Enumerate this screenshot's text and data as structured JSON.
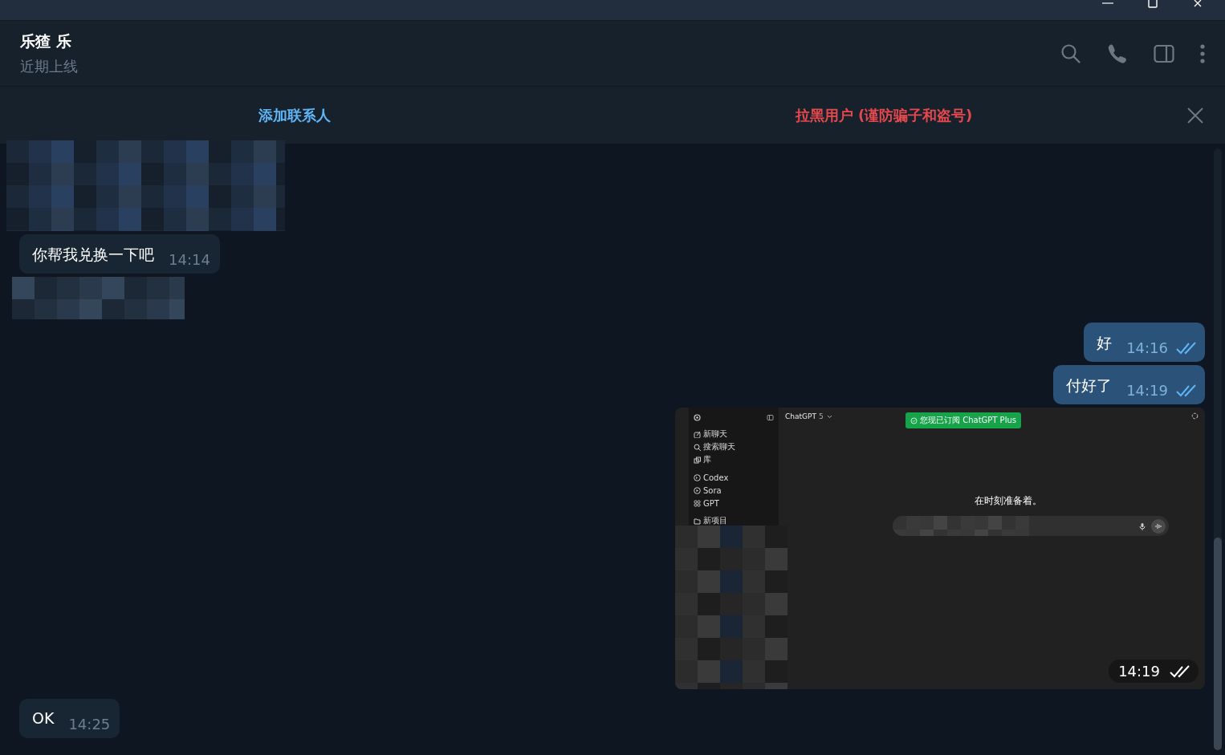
{
  "chat_header": {
    "name": "乐猹 乐",
    "status": "近期上线"
  },
  "action_bar": {
    "buttons": [
      {
        "label": "添加联系人",
        "kind": "add"
      },
      {
        "label": "拉黑用户 (谨防骗子和盗号)",
        "kind": "block"
      }
    ]
  },
  "messages": [
    {
      "kind": "picture",
      "outgoing": false
    },
    {
      "kind": "text",
      "outgoing": false,
      "text": "你帮我兑换一下吧",
      "time": "14:14"
    },
    {
      "kind": "picture",
      "outgoing": false
    },
    {
      "kind": "text",
      "outgoing": true,
      "text": "好",
      "time": "14:16",
      "read": true
    },
    {
      "kind": "text",
      "outgoing": true,
      "text": "付好了",
      "time": "14:19",
      "read": true
    },
    {
      "kind": "screenshot",
      "outgoing": true,
      "time": "14:19",
      "read": true,
      "screenshot": {
        "title": "ChatGPT",
        "model": "5",
        "badge": "您现已订阅 ChatGPT Plus",
        "prompt": "在时刻准备着。",
        "sidebar": {
          "sections": [
            {
              "items": [
                {
                  "label": "新聊天",
                  "kind": "edit"
                },
                {
                  "label": "搜索聊天",
                  "kind": "search"
                },
                {
                  "label": "库",
                  "kind": "library"
                }
              ]
            },
            {
              "items": [
                {
                  "label": "Codex",
                  "kind": "codex"
                },
                {
                  "label": "Sora",
                  "kind": "play"
                },
                {
                  "label": "GPT",
                  "kind": "grid"
                }
              ]
            },
            {
              "items": [
                {
                  "label": "新项目",
                  "kind": "folder"
                }
              ]
            }
          ]
        }
      }
    },
    {
      "kind": "text",
      "outgoing": false,
      "text": "OK",
      "time": "14:25"
    }
  ]
}
